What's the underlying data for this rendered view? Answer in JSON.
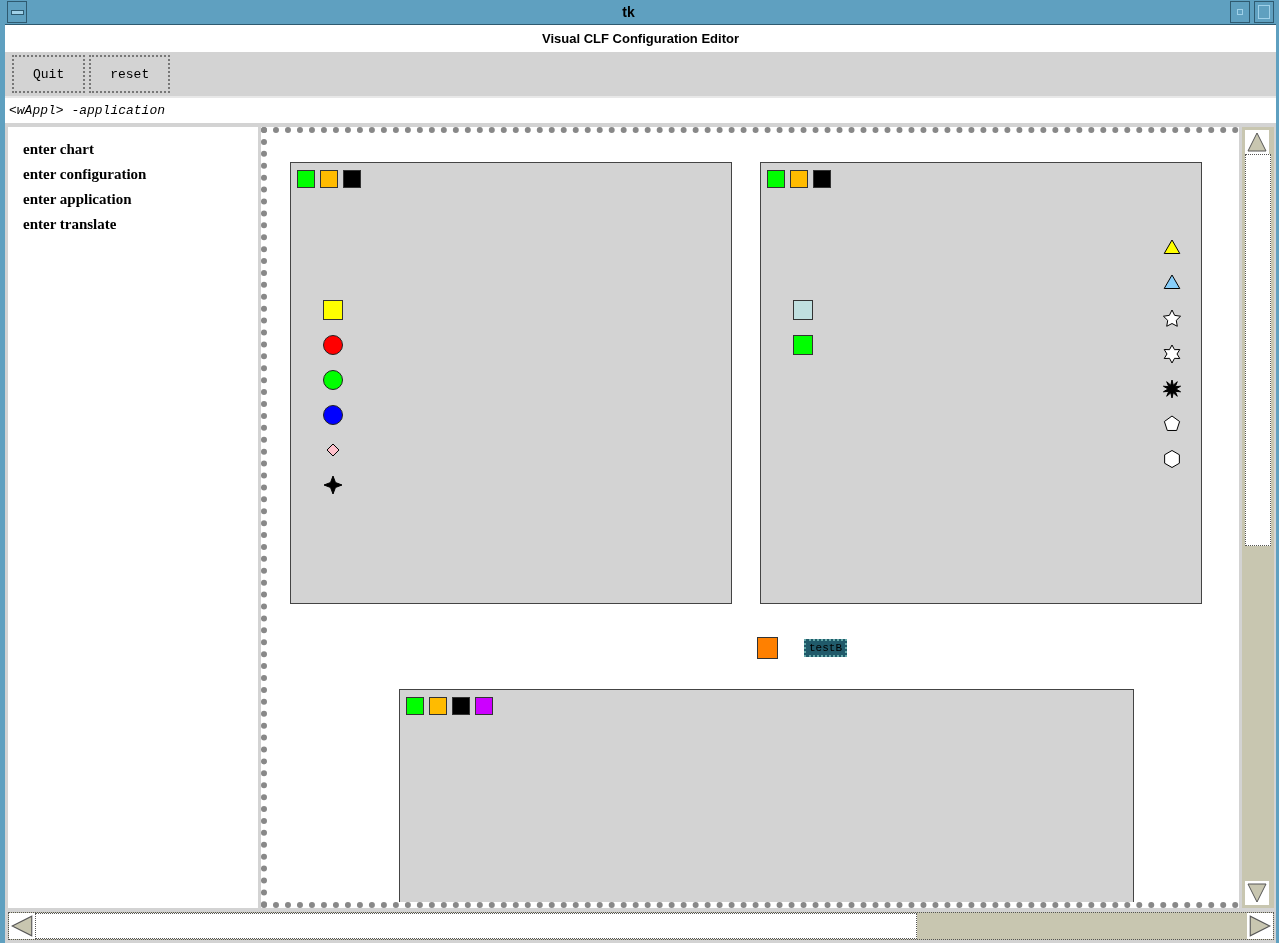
{
  "window": {
    "title": "tk"
  },
  "header": "Visual CLF Configuration Editor",
  "toolbar": [
    "Quit",
    "reset"
  ],
  "status": "<wAppl> -application",
  "sidebar": {
    "items": [
      "enter chart",
      "enter configuration",
      "enter application",
      "enter translate"
    ]
  },
  "canvas": {
    "panels": [
      {
        "swatches": [
          {
            "color": "#00ff00"
          },
          {
            "color": "#ffbb00"
          },
          {
            "color": "#000000"
          }
        ],
        "left_shapes": [
          {
            "kind": "square",
            "color": "#ffff00"
          },
          {
            "kind": "circle",
            "color": "#ff0000"
          },
          {
            "kind": "circle",
            "color": "#00ff00"
          },
          {
            "kind": "circle",
            "color": "#0000ff"
          },
          {
            "kind": "diamond",
            "color": "#ffc0cb"
          },
          {
            "kind": "star4",
            "color": "#000000"
          }
        ]
      },
      {
        "swatches": [
          {
            "color": "#00ff00"
          },
          {
            "color": "#ffbb00"
          },
          {
            "color": "#000000"
          }
        ],
        "left_shapes": [
          {
            "kind": "square",
            "color": "#c0e0e0"
          },
          {
            "kind": "square",
            "color": "#00ff00"
          }
        ],
        "right_shapes": [
          {
            "kind": "triangle",
            "color": "#ffff00"
          },
          {
            "kind": "triangle",
            "color": "#87cefa"
          },
          {
            "kind": "star5",
            "color": "#ffffff"
          },
          {
            "kind": "star6",
            "color": "#ffffff"
          },
          {
            "kind": "burst",
            "color": "#000000"
          },
          {
            "kind": "pentagon",
            "color": "#ffffff"
          },
          {
            "kind": "hexagon",
            "color": "#ffffff"
          }
        ]
      }
    ],
    "middle": {
      "square": {
        "color": "#ff8000"
      },
      "button": "testB"
    },
    "bottom_panel": {
      "swatches": [
        {
          "color": "#00ff00"
        },
        {
          "color": "#ffbb00"
        },
        {
          "color": "#000000"
        },
        {
          "color": "#cc00ff"
        }
      ]
    }
  }
}
